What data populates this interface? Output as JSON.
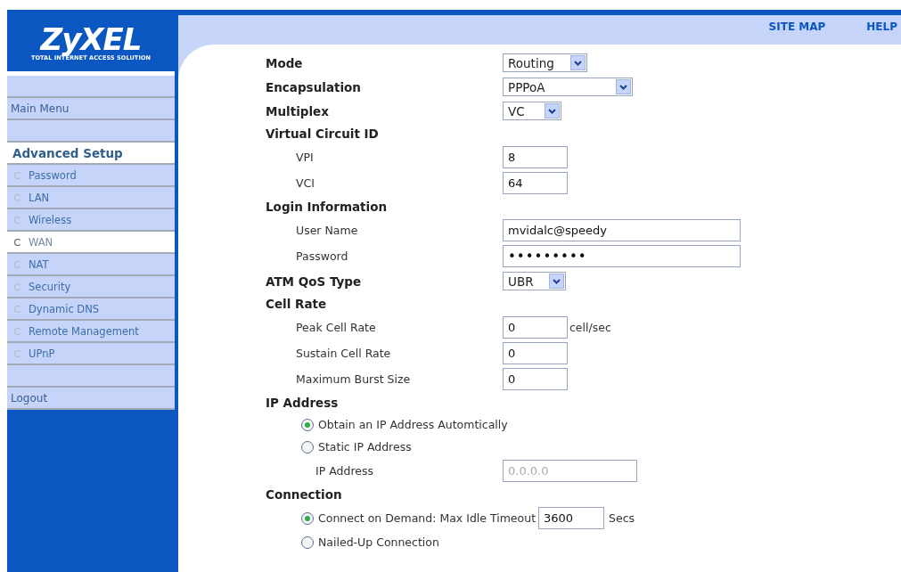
{
  "logo": {
    "name": "ZyXEL",
    "tagline": "TOTAL INTERNET ACCESS SOLUTION"
  },
  "header_links": [
    "SITE MAP",
    "HELP"
  ],
  "sidebar": {
    "main_menu": "Main Menu",
    "section": "Advanced Setup",
    "items": [
      {
        "label": "Password",
        "selected": false
      },
      {
        "label": "LAN",
        "selected": false
      },
      {
        "label": "Wireless",
        "selected": false
      },
      {
        "label": "WAN",
        "selected": true
      },
      {
        "label": "NAT",
        "selected": false
      },
      {
        "label": "Security",
        "selected": false
      },
      {
        "label": "Dynamic DNS",
        "selected": false
      },
      {
        "label": "Remote Management",
        "selected": false
      },
      {
        "label": "UPnP",
        "selected": false
      }
    ],
    "logout": "Logout"
  },
  "form": [
    {
      "kind": "select",
      "label": "Mode",
      "value": "Routing"
    },
    {
      "kind": "select",
      "label": "Encapsulation",
      "value": "PPPoA"
    },
    {
      "kind": "select",
      "label": "Multiplex",
      "value": "VC"
    },
    {
      "kind": "heading",
      "label": "Virtual Circuit ID"
    },
    {
      "kind": "short_field",
      "label": "VPI",
      "value": "8"
    },
    {
      "kind": "short_field",
      "label": "VCI",
      "value": "64"
    },
    {
      "kind": "heading",
      "label": "Login Information"
    },
    {
      "kind": "long_field",
      "label": "User Name",
      "value": "mvidalc@speedy"
    },
    {
      "kind": "password",
      "label": "Password",
      "value": "•••••••••"
    },
    {
      "kind": "select",
      "label": "ATM QoS Type",
      "value": "UBR"
    },
    {
      "kind": "heading",
      "label": "Cell Rate"
    },
    {
      "kind": "short_field",
      "label": "Peak Cell Rate",
      "value": "0",
      "unit": "cell/sec"
    },
    {
      "kind": "short_field",
      "label": "Sustain Cell Rate",
      "value": "0"
    },
    {
      "kind": "short_field",
      "label": "Maximum Burst Size",
      "value": "0"
    },
    {
      "kind": "heading",
      "label": "IP Address"
    },
    {
      "kind": "radio",
      "label": "Obtain an IP Address Automtically",
      "selected": true
    },
    {
      "kind": "radio",
      "label": "Static IP Address",
      "selected": false,
      "children": [
        {
          "kind": "ip_field",
          "label": "IP Address",
          "value": "0.0.0.0",
          "disabled": true
        }
      ]
    },
    {
      "kind": "heading",
      "label": "Connection"
    },
    {
      "kind": "radio",
      "label": "Connect on Demand: Max Idle Timeout",
      "selected": true,
      "value": "3600",
      "unit": "Secs"
    },
    {
      "kind": "radio",
      "label": "Nailed-Up Connection",
      "selected": false
    }
  ]
}
